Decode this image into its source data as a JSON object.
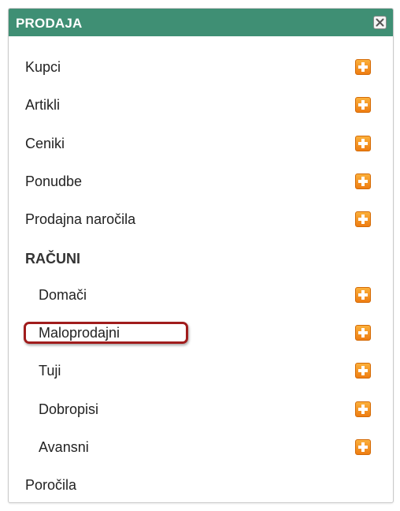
{
  "panel": {
    "title": "PRODAJA",
    "close_icon": "close-icon"
  },
  "menu": {
    "items": [
      {
        "label": "Kupci"
      },
      {
        "label": "Artikli"
      },
      {
        "label": "Ceniki"
      },
      {
        "label": "Ponudbe"
      },
      {
        "label": "Prodajna naročila"
      }
    ],
    "section": {
      "label": "RAČUNI",
      "items": [
        {
          "label": "Domači"
        },
        {
          "label": "Maloprodajni"
        },
        {
          "label": "Tuji"
        },
        {
          "label": "Dobropisi"
        },
        {
          "label": "Avansni"
        }
      ]
    },
    "footer_item": {
      "label": "Poročila"
    }
  },
  "icons": {
    "add": "plus-icon",
    "add_color": "#f39a21",
    "header_color": "#3f8f74",
    "highlight_color": "#a01c1c"
  }
}
